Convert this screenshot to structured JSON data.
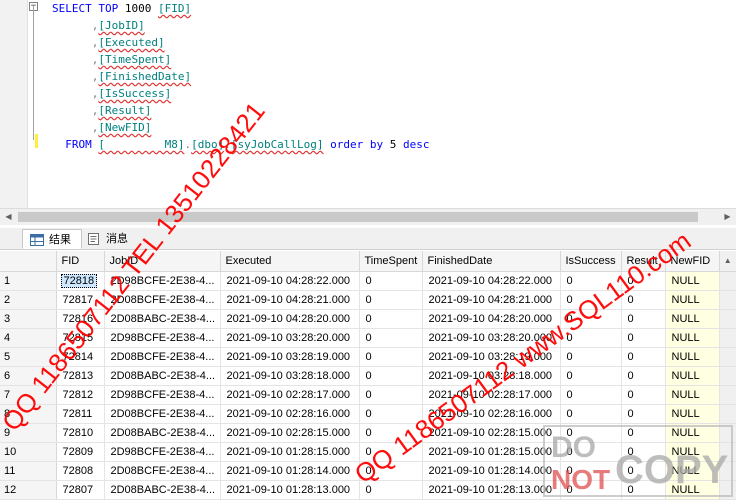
{
  "editor": {
    "sql_lines": [
      [
        {
          "t": "kw",
          "v": "SELECT "
        },
        {
          "t": "kw",
          "v": "TOP "
        },
        {
          "t": "num",
          "v": "1000 "
        },
        {
          "t": "id",
          "v": "[FID]"
        }
      ],
      [
        {
          "t": "pun",
          "v": "      ,"
        },
        {
          "t": "id",
          "v": "[JobID]"
        }
      ],
      [
        {
          "t": "pun",
          "v": "      ,"
        },
        {
          "t": "id",
          "v": "[Executed]"
        }
      ],
      [
        {
          "t": "pun",
          "v": "      ,"
        },
        {
          "t": "id",
          "v": "[TimeSpent]"
        }
      ],
      [
        {
          "t": "pun",
          "v": "      ,"
        },
        {
          "t": "id",
          "v": "[FinishedDate]"
        }
      ],
      [
        {
          "t": "pun",
          "v": "      ,"
        },
        {
          "t": "id",
          "v": "[IsSuccess]"
        }
      ],
      [
        {
          "t": "pun",
          "v": "      ,"
        },
        {
          "t": "id",
          "v": "[Result]"
        }
      ],
      [
        {
          "t": "pun",
          "v": "      ,"
        },
        {
          "t": "id",
          "v": "[NewFID]"
        }
      ],
      [
        {
          "t": "kw",
          "v": "  FROM "
        },
        {
          "t": "id",
          "v": "[         M8]"
        },
        {
          "t": "pun",
          "v": "."
        },
        {
          "t": "id",
          "v": "[dbo]"
        },
        {
          "t": "pun",
          "v": "."
        },
        {
          "t": "id",
          "v": "[syJobCallLog]"
        },
        {
          "t": "txt",
          "v": " "
        },
        {
          "t": "kw",
          "v": "order by "
        },
        {
          "t": "num",
          "v": "5 "
        },
        {
          "t": "kw",
          "v": "desc"
        }
      ]
    ]
  },
  "tabs": {
    "results_label": "结果",
    "messages_label": "消息"
  },
  "grid": {
    "columns": [
      "FID",
      "JobID",
      "Executed",
      "TimeSpent",
      "FinishedDate",
      "IsSuccess",
      "Result",
      "NewFID"
    ],
    "rows": [
      [
        "1",
        "72818",
        "2D98BCFE-2E38-4...",
        "2021-09-10 04:28:22.000",
        "0",
        "2021-09-10 04:28:22.000",
        "0",
        "0",
        "NULL"
      ],
      [
        "2",
        "72817",
        "2D08BCFE-2E38-4...",
        "2021-09-10 04:28:21.000",
        "0",
        "2021-09-10 04:28:21.000",
        "0",
        "0",
        "NULL"
      ],
      [
        "3",
        "72816",
        "2D08BABC-2E38-4...",
        "2021-09-10 04:28:20.000",
        "0",
        "2021-09-10 04:28:20.000",
        "0",
        "0",
        "NULL"
      ],
      [
        "4",
        "72815",
        "2D98BCFE-2E38-4...",
        "2021-09-10 03:28:20.000",
        "0",
        "2021-09-10 03:28:20.000",
        "0",
        "0",
        "NULL"
      ],
      [
        "5",
        "72814",
        "2D08BCFE-2E38-4...",
        "2021-09-10 03:28:19.000",
        "0",
        "2021-09-10 03:28:19.000",
        "0",
        "0",
        "NULL"
      ],
      [
        "6",
        "72813",
        "2D08BABC-2E38-4...",
        "2021-09-10 03:28:18.000",
        "0",
        "2021-09-10 03:28:18.000",
        "0",
        "0",
        "NULL"
      ],
      [
        "7",
        "72812",
        "2D98BCFE-2E38-4...",
        "2021-09-10 02:28:17.000",
        "0",
        "2021-09-10 02:28:17.000",
        "0",
        "0",
        "NULL"
      ],
      [
        "8",
        "72811",
        "2D08BCFE-2E38-4...",
        "2021-09-10 02:28:16.000",
        "0",
        "2021-09-10 02:28:16.000",
        "0",
        "0",
        "NULL"
      ],
      [
        "9",
        "72810",
        "2D08BABC-2E38-4...",
        "2021-09-10 02:28:15.000",
        "0",
        "2021-09-10 02:28:15.000",
        "0",
        "0",
        "NULL"
      ],
      [
        "10",
        "72809",
        "2D98BCFE-2E38-4...",
        "2021-09-10 01:28:15.000",
        "0",
        "2021-09-10 01:28:15.000",
        "0",
        "0",
        "NULL"
      ],
      [
        "11",
        "72808",
        "2D08BCFE-2E38-4...",
        "2021-09-10 01:28:14.000",
        "0",
        "2021-09-10 01:28:14.000",
        "0",
        "0",
        "NULL"
      ],
      [
        "12",
        "72807",
        "2D08BABC-2E38-4...",
        "2021-09-10 01:28:13.000",
        "0",
        "2021-09-10 01:28:13.000",
        "0",
        "0",
        "NULL"
      ]
    ]
  },
  "watermarks": {
    "left": "QQ 1186507112 TEL 13510228421",
    "right": "QQ 1186507112 www.SQL110.com",
    "stamp_do": "DO",
    "stamp_not": "NOT",
    "stamp_copy": "COPY"
  },
  "colors": {
    "keyword": "#0000ff",
    "identifier": "#008080",
    "watermark": "#ff0000",
    "null_cell": "#ffffe1"
  }
}
